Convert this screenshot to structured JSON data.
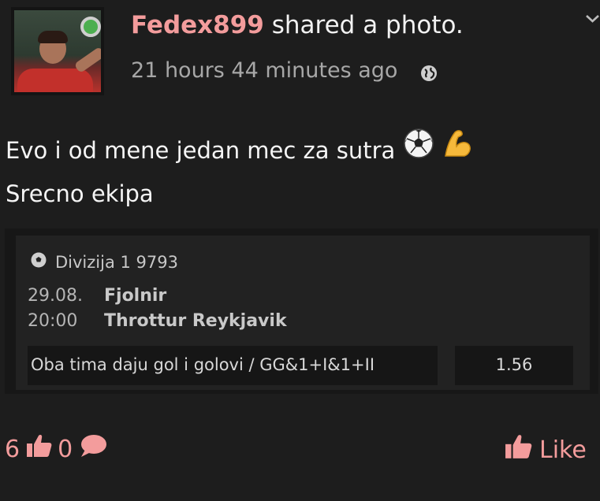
{
  "post": {
    "username": "Fedex899",
    "action": "shared a photo.",
    "timestamp": "21 hours 44 minutes ago",
    "text_line1": "Evo i od mene jedan mec za sutra",
    "text_line2": "Srecno ekipa",
    "emojis": [
      "soccer-ball",
      "flexed-biceps"
    ]
  },
  "ticket": {
    "league": "Divizija 1 9793",
    "date": "29.08.",
    "time": "20:00",
    "home_team": "Fjolnir",
    "away_team": "Throttur Reykjavik",
    "bet": "Oba tima daju gol i golovi / GG&1+I&1+II",
    "odd": "1.56"
  },
  "footer": {
    "likes_count": "6",
    "comments_count": "0",
    "like_label": "Like"
  },
  "colors": {
    "background": "#1d1d1d",
    "accent": "#f39c9c",
    "online": "#4caf50"
  }
}
